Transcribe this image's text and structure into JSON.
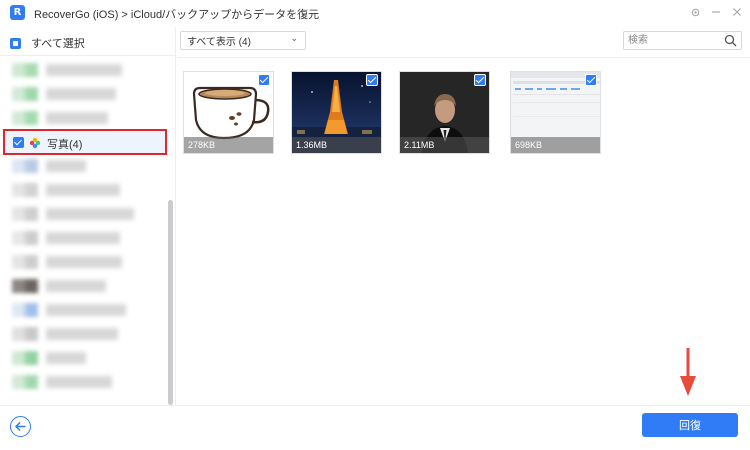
{
  "window": {
    "title": "RecoverGo (iOS) > iCloud/バックアップからデータを復元",
    "logo_letter": "R"
  },
  "sidebar": {
    "select_all_label": "すべて選択",
    "selected_item_label": "写真(4)"
  },
  "toolbar": {
    "filter_value": "すべて表示 (4)",
    "search_placeholder": "検索"
  },
  "photos": [
    {
      "size": "278KB",
      "content": "coffee-cup",
      "checked": true
    },
    {
      "size": "1.36MB",
      "content": "night-tower",
      "checked": true
    },
    {
      "size": "2.11MB",
      "content": "man-in-suit",
      "checked": true
    },
    {
      "size": "698KB",
      "content": "screenshot",
      "checked": true
    }
  ],
  "footer": {
    "recover_label": "回復"
  },
  "colors": {
    "accent": "#2f7cf6",
    "highlight_border": "#e0252c",
    "annotation_arrow": "#e84a3c"
  }
}
